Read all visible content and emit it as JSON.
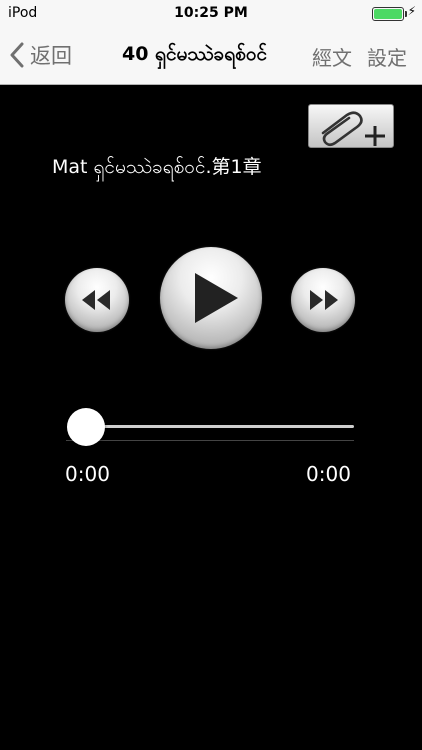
{
  "status_bar": {
    "carrier": "iPod",
    "time": "10:25 PM",
    "battery_level": 1.0,
    "battery_color": "#4cd964"
  },
  "nav": {
    "back_label": "返回",
    "back_icon": "chevron-left-icon",
    "title": "40 ရှင်မဿဲခရစ်ဝင်",
    "scripture_label": "經文",
    "settings_label": "設定"
  },
  "attach_button": {
    "icon": "paperclip-plus-icon"
  },
  "player": {
    "track_title": "Mat ရှင်မဿဲခရစ်ဝင်.第1章",
    "rewind_icon": "rewind-icon",
    "play_icon": "play-icon",
    "forward_icon": "fast-forward-icon",
    "progress": 0,
    "elapsed": "0:00",
    "total": "0:00"
  }
}
